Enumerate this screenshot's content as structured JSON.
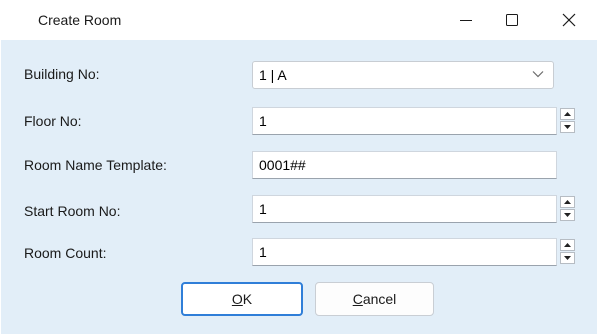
{
  "window": {
    "title": "Create Room"
  },
  "form": {
    "building": {
      "label": "Building No:",
      "value": "1 | A"
    },
    "floor": {
      "label": "Floor No:",
      "value": "1"
    },
    "template": {
      "label": "Room Name Template:",
      "value": "0001##"
    },
    "start_room": {
      "label": "Start Room No:",
      "value": "1"
    },
    "room_count": {
      "label": "Room Count:",
      "value": "1"
    }
  },
  "buttons": {
    "ok": {
      "mnemonic": "O",
      "rest": "K"
    },
    "cancel": {
      "mnemonic": "C",
      "rest": "ancel"
    }
  },
  "colors": {
    "client_bg": "#e2eef8",
    "accent": "#2f7ed8"
  }
}
